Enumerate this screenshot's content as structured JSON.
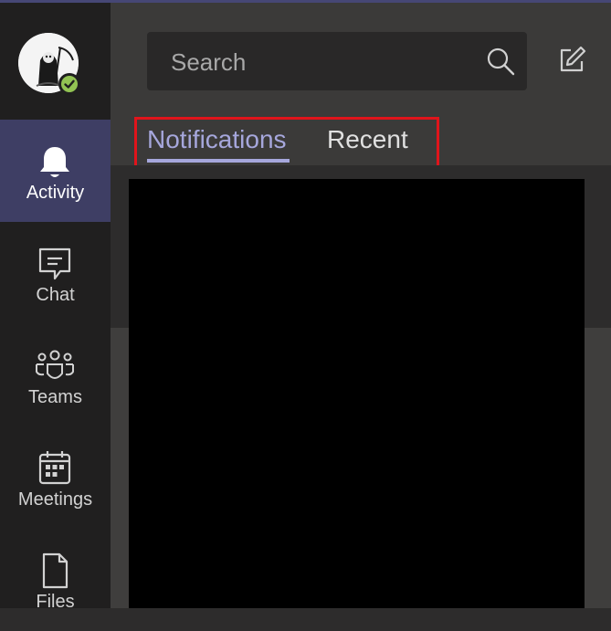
{
  "colors": {
    "rail_bg": "#201f1f",
    "rail_active": "#3e3e64",
    "accent": "#a6a7dc",
    "presence": "#92c353",
    "highlight_box": "#e0141b"
  },
  "profile": {
    "avatar_icon": "reaper-avatar-icon",
    "presence_icon": "available-check-icon"
  },
  "nav": {
    "items": [
      {
        "label": "Activity",
        "icon": "bell-icon",
        "active": true
      },
      {
        "label": "Chat",
        "icon": "chat-icon",
        "active": false
      },
      {
        "label": "Teams",
        "icon": "teams-icon",
        "active": false
      },
      {
        "label": "Meetings",
        "icon": "calendar-icon",
        "active": false
      },
      {
        "label": "Files",
        "icon": "file-icon",
        "active": false
      }
    ]
  },
  "search": {
    "placeholder": "Search",
    "value": ""
  },
  "tabs": [
    {
      "label": "Notifications",
      "selected": true
    },
    {
      "label": "Recent",
      "selected": false
    }
  ]
}
